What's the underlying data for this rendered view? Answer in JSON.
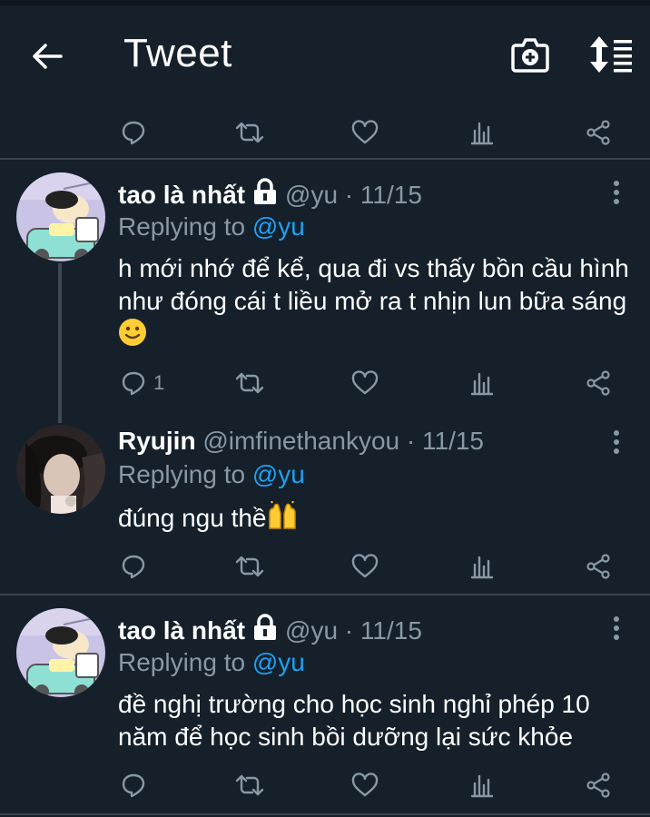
{
  "header": {
    "title": "Tweet"
  },
  "tweets": [
    {
      "name": "tao là nhất",
      "handle": "@yu",
      "time": "11/15",
      "replying_prefix": "Replying to",
      "replying_mention": "@yu",
      "text": "h mới nhớ để kể, qua đi vs thấy bồn cầu hình như đóng cái t liều mở ra t nhịn lun bữa sáng",
      "emoji": "slightly-smiling-face",
      "reply_count": "1"
    },
    {
      "name": "Ryujin",
      "handle": "@imfinethankyou",
      "time": "11/15",
      "replying_prefix": "Replying to",
      "replying_mention": "@yu",
      "text": "đúng ngu thề",
      "emoji": "raising-hands"
    },
    {
      "name": "tao là nhất",
      "handle": "@yu",
      "time": "11/15",
      "replying_prefix": "Replying to",
      "replying_mention": "@yu",
      "text": "đề nghị trường cho học sinh nghỉ phép 10 năm để học sinh bồi dưỡng lại sức khỏe"
    }
  ],
  "colors": {
    "background": "#15202b",
    "secondary_text": "#8899a6",
    "accent": "#1da1f2",
    "divider": "#38444d"
  },
  "time_separator": "·"
}
